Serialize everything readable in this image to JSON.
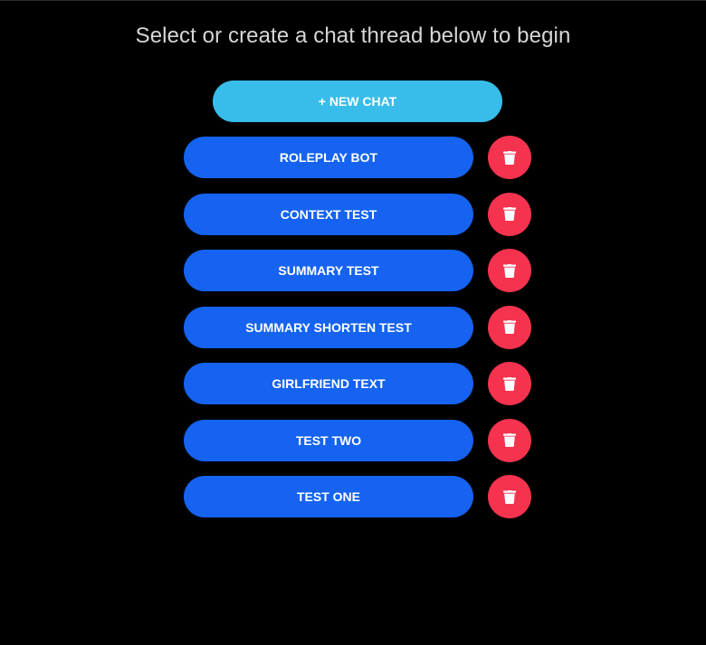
{
  "header": {
    "title": "Select or create a chat thread below to begin"
  },
  "actions": {
    "new_chat_label": "+ NEW CHAT"
  },
  "threads": [
    {
      "label": "ROLEPLAY BOT",
      "delete_icon": "trash-icon"
    },
    {
      "label": "CONTEXT TEST",
      "delete_icon": "trash-icon"
    },
    {
      "label": "SUMMARY TEST",
      "delete_icon": "trash-icon"
    },
    {
      "label": "SUMMARY SHORTEN TEST",
      "delete_icon": "trash-icon"
    },
    {
      "label": "GIRLFRIEND TEXT",
      "delete_icon": "trash-icon"
    },
    {
      "label": "TEST TWO",
      "delete_icon": "trash-icon"
    },
    {
      "label": "TEST ONE",
      "delete_icon": "trash-icon"
    }
  ],
  "colors": {
    "background": "#000000",
    "title_text": "#d6d6d6",
    "new_chat_button": "#38bdea",
    "thread_button": "#1563f0",
    "delete_button": "#f5334f",
    "button_text": "#ffffff"
  }
}
